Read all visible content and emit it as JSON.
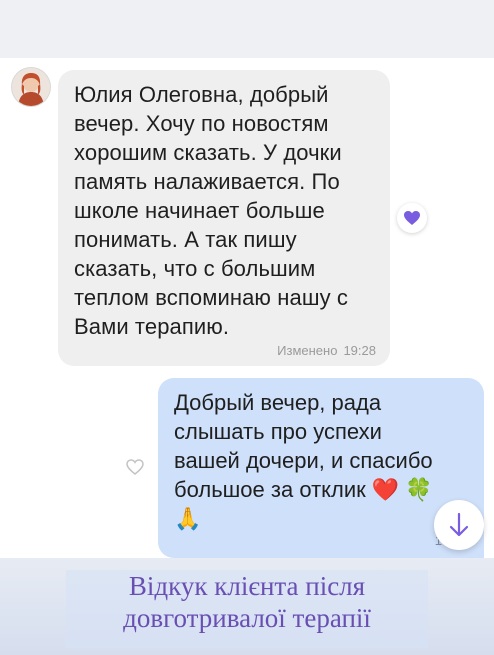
{
  "incoming": {
    "lines": [
      "Юлия Олеговна, добрый",
      "вечер. Хочу по новостям",
      "хорошим сказать. У дочки",
      "память налаживается. По",
      "школе начинает больше",
      "понимать. А так пишу",
      "сказать, что с большим",
      "теплом вспоминаю нашу с",
      "Вами терапию."
    ],
    "edited_label": "Изменено",
    "time": "19:28",
    "reaction_icon": "purple-heart-icon"
  },
  "outgoing": {
    "lines": [
      "Добрый вечер, рада",
      "слышать про успехи",
      "вашей дочери, и спасибо",
      "большое за отклик"
    ],
    "emoji_line_1": "❤️ 🍀",
    "emoji_line_2": "🙏",
    "time": "19:3"
  },
  "caption": {
    "line1": "Відкук клієнта після",
    "line2": "довготривалої терапії"
  },
  "colors": {
    "incoming_bubble": "#efefef",
    "outgoing_bubble": "#cfe0fa",
    "accent_purple": "#7a5ce0",
    "caption_text": "#6a4fb3"
  }
}
